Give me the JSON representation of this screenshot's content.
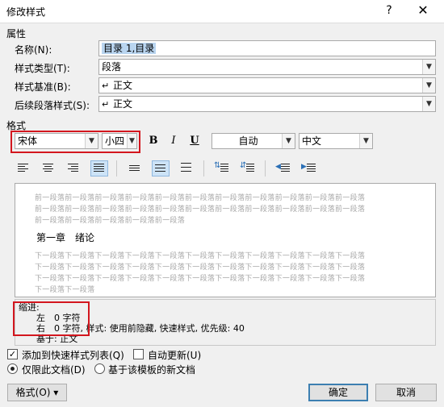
{
  "window": {
    "title": "修改样式",
    "help_label": "?",
    "close_label": "✕"
  },
  "properties": {
    "section_label": "属性",
    "name": {
      "label": "名称(N):",
      "value": "目录 1,目录"
    },
    "style_type": {
      "label": "样式类型(T):",
      "value": "段落"
    },
    "based_on": {
      "label": "样式基准(B):",
      "value": "正文",
      "icon": "paragraph-arrow-icon"
    },
    "next_style": {
      "label": "后续段落样式(S):",
      "value": "正文",
      "icon": "paragraph-arrow-icon"
    }
  },
  "formatting": {
    "section_label": "格式",
    "font": "宋体",
    "size": "小四",
    "bold_label": "B",
    "italic_label": "I",
    "underline_label": "U",
    "color": "自动",
    "script": "中文"
  },
  "preview": {
    "prev_para_lines": [
      "前一段落前一段落前一段落前一段落前一段落前一段落前一段落前一段落前一段落前一段落前一段落",
      "前一段落前一段落前一段落前一段落前一段落前一段落前一段落前一段落前一段落前一段落前一段落",
      "前一段落前一段落前一段落前一段落前一段落"
    ],
    "sample_text": "第一章　绪论",
    "next_para_lines": [
      "下一段落下一段落下一段落下一段落下一段落下一段落下一段落下一段落下一段落下一段落下一段落",
      "下一段落下一段落下一段落下一段落下一段落下一段落下一段落下一段落下一段落下一段落下一段落",
      "下一段落下一段落下一段落下一段落下一段落下一段落下一段落下一段落下一段落下一段落下一段落",
      "下一段落下一段落"
    ]
  },
  "description": {
    "line1": "缩进:",
    "line2": "左　0 字符",
    "line3": "右　0 字符, 样式: 使用前隐藏, 快速样式, 优先级: 40",
    "line4": "基于: 正文"
  },
  "options": {
    "add_to_quick_styles": {
      "label": "添加到快速样式列表(Q)",
      "checked": true
    },
    "auto_update": {
      "label": "自动更新(U)",
      "checked": false
    },
    "only_this_doc": {
      "label": "仅限此文档(D)",
      "selected": true
    },
    "new_docs_template": {
      "label": "基于该模板的新文档",
      "selected": false
    }
  },
  "buttons": {
    "format": "格式(O) ▾",
    "ok": "确定",
    "cancel": "取消"
  },
  "colors": {
    "highlight_red": "#d3161e",
    "selection_blue": "#b9d5f0",
    "active_tool": "#cde3f7"
  }
}
